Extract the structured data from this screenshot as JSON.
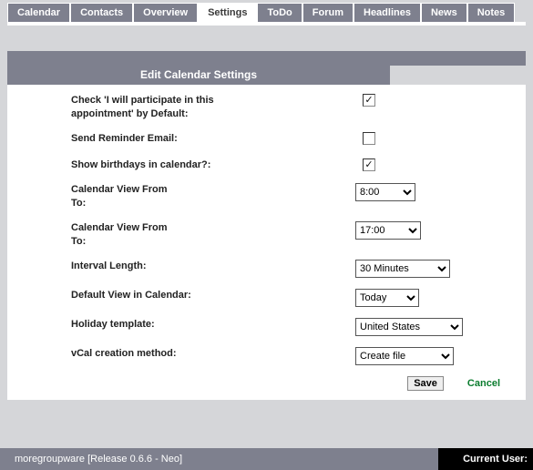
{
  "tabs": [
    {
      "label": "Calendar"
    },
    {
      "label": "Contacts"
    },
    {
      "label": "Overview"
    },
    {
      "label": "Settings",
      "active": true
    },
    {
      "label": "ToDo"
    },
    {
      "label": "Forum"
    },
    {
      "label": "Headlines"
    },
    {
      "label": "News"
    },
    {
      "label": "Notes"
    }
  ],
  "panel": {
    "title": "Edit Calendar Settings",
    "fields": {
      "participate": {
        "label": "Check 'I will participate in this appointment' by Default:",
        "checked": true
      },
      "reminder": {
        "label": "Send Reminder Email:",
        "checked": false
      },
      "birthdays": {
        "label": "Show birthdays in calendar?:",
        "checked": true
      },
      "view_from": {
        "label": "Calendar View From\nTo:",
        "value": "8:00"
      },
      "view_to": {
        "label": "Calendar View From\nTo:",
        "value": "17:00"
      },
      "interval": {
        "label": "Interval Length:",
        "value": "30 Minutes"
      },
      "default_view": {
        "label": "Default View in Calendar:",
        "value": "Today"
      },
      "holiday": {
        "label": "Holiday template:",
        "value": "United States"
      },
      "vcal": {
        "label": "vCal creation method:",
        "value": "Create file"
      }
    },
    "actions": {
      "save": "Save",
      "cancel": "Cancel"
    }
  },
  "footer": {
    "left": "moregroupware [Release 0.6.6 - Neo]",
    "right": "Current User:"
  }
}
